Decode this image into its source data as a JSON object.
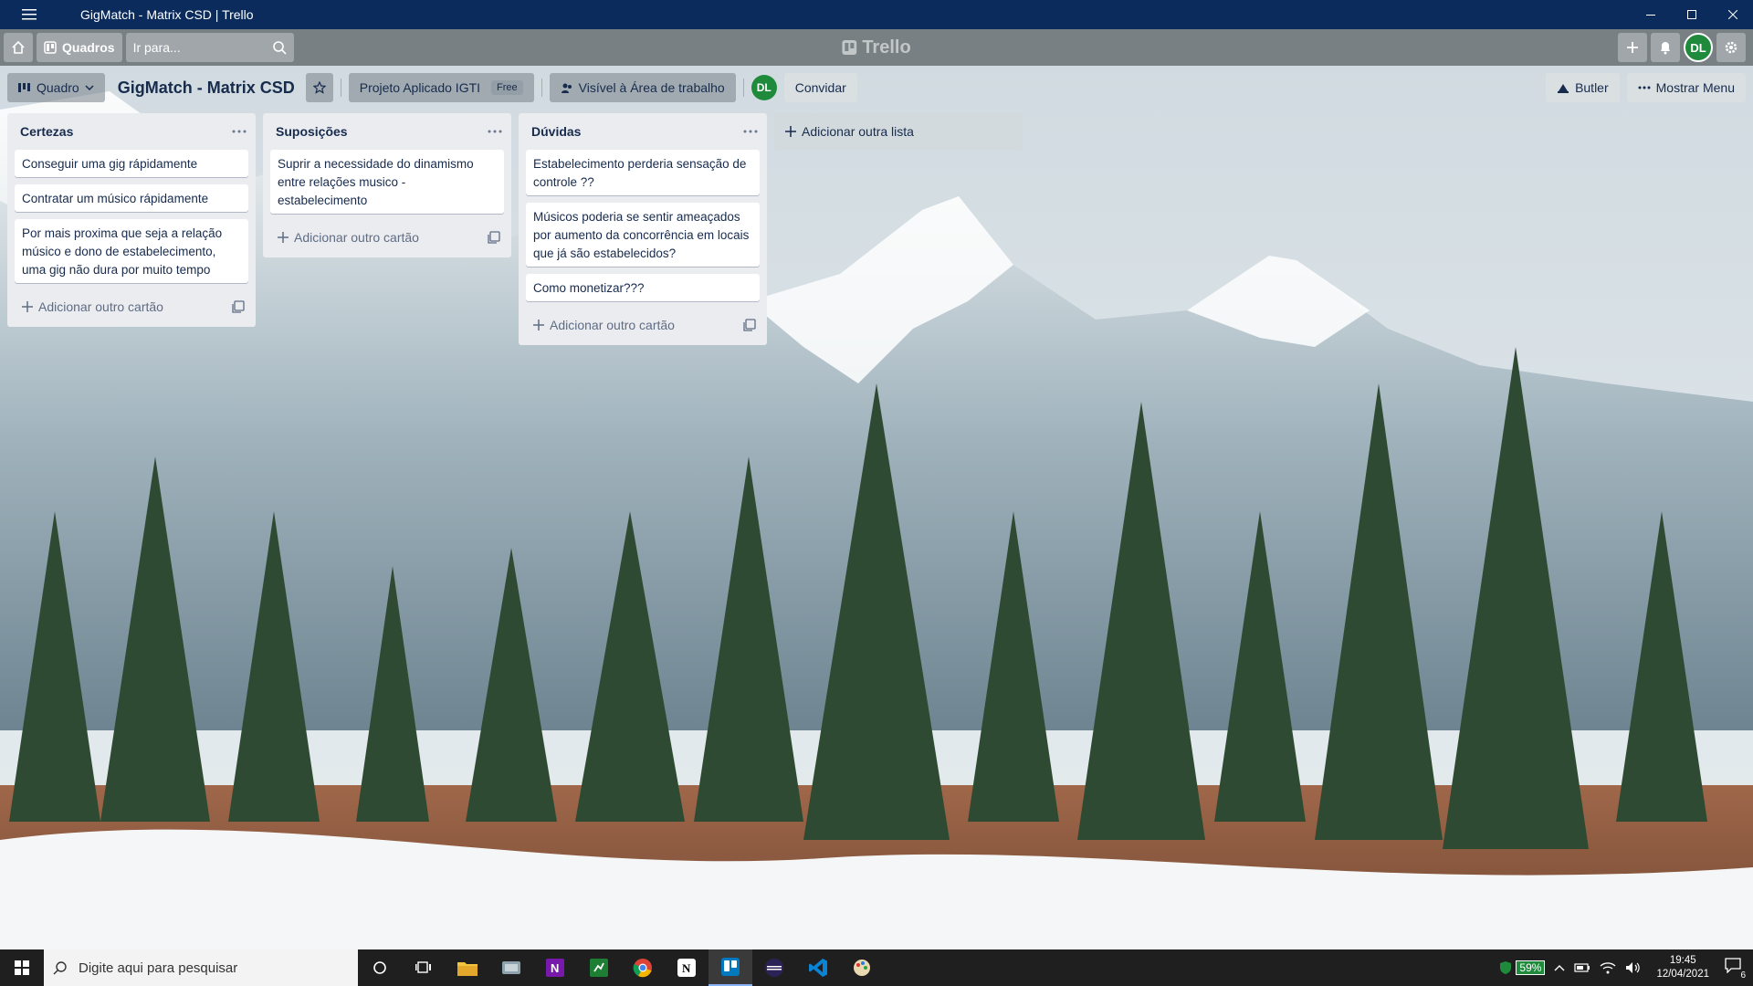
{
  "window": {
    "title": "GigMatch - Matrix CSD | Trello"
  },
  "header": {
    "boards_label": "Quadros",
    "search_placeholder": "Ir para...",
    "logo_text": "Trello",
    "user_initials": "DL"
  },
  "board": {
    "view_label": "Quadro",
    "name": "GigMatch - Matrix CSD",
    "team_name": "Projeto Aplicado IGTI",
    "team_badge": "Free",
    "visibility": "Visível à Área de trabalho",
    "member_initials": "DL",
    "invite_label": "Convidar",
    "butler_label": "Butler",
    "menu_label": "Mostrar Menu"
  },
  "lists": [
    {
      "title": "Certezas",
      "cards": [
        "Conseguir uma gig rápidamente",
        "Contratar um músico rápidamente",
        "Por mais proxima que seja a relação músico e dono de estabelecimento, uma gig não dura por muito tempo"
      ],
      "add_card_label": "Adicionar outro cartão"
    },
    {
      "title": "Suposições",
      "cards": [
        "Suprir a necessidade do dinamismo entre relações musico - estabelecimento"
      ],
      "add_card_label": "Adicionar outro cartão"
    },
    {
      "title": "Dúvidas",
      "cards": [
        "Estabelecimento perderia sensação de controle ??",
        "Músicos poderia se sentir ameaçados por aumento da concorrência em locais que já são estabelecidos?",
        "Como monetizar???"
      ],
      "add_card_label": "Adicionar outro cartão"
    }
  ],
  "add_list_label": "Adicionar outra lista",
  "taskbar": {
    "search_placeholder": "Digite aqui para pesquisar",
    "battery": "59%",
    "time": "19:45",
    "date": "12/04/2021",
    "notifications": "6"
  }
}
